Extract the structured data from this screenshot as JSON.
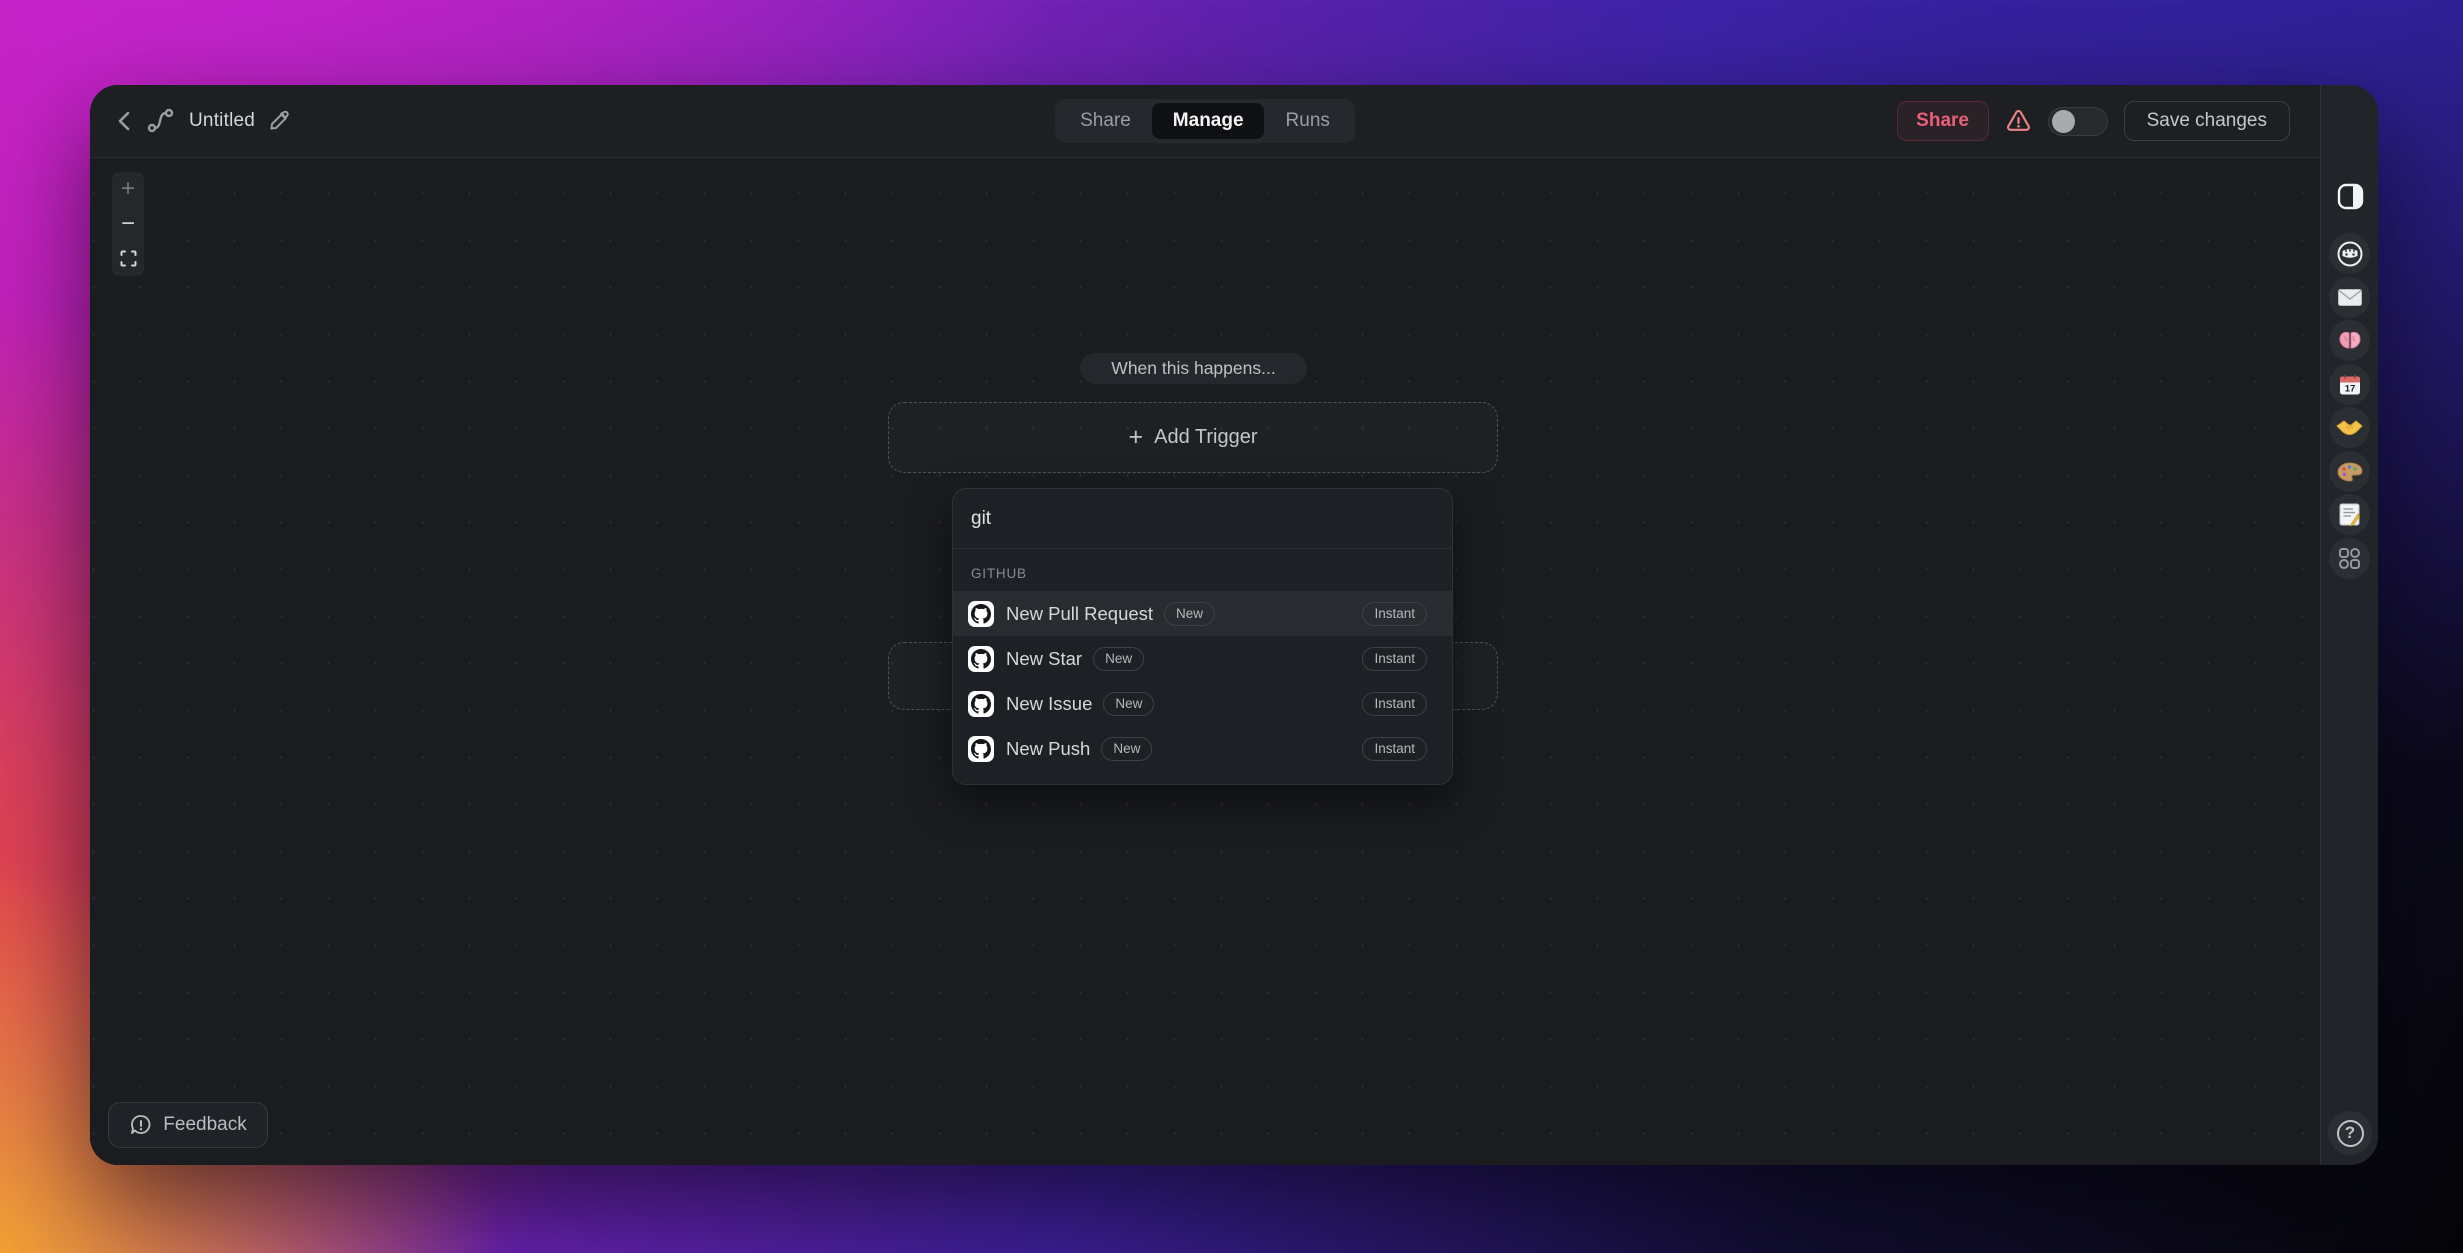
{
  "window": {
    "title": "Untitled"
  },
  "topbar": {
    "tabs": [
      {
        "label": "Share",
        "active": false
      },
      {
        "label": "Manage",
        "active": true
      },
      {
        "label": "Runs",
        "active": false
      }
    ],
    "share_button": "Share",
    "save_button": "Save changes",
    "toggle_state": "off"
  },
  "canvas": {
    "when_label": "When this happens...",
    "add_trigger": {
      "plus": "+",
      "label": "Add Trigger"
    },
    "zoom_controls": {
      "zoom_in": "+",
      "zoom_out": "−",
      "fit": "fit-view"
    }
  },
  "trigger_search": {
    "query": "git",
    "section": "GITHUB",
    "results": [
      {
        "name": "New Pull Request",
        "badge": "New",
        "tag": "Instant",
        "highlighted": true
      },
      {
        "name": "New Star",
        "badge": "New",
        "tag": "Instant",
        "highlighted": false
      },
      {
        "name": "New Issue",
        "badge": "New",
        "tag": "Instant",
        "highlighted": false
      },
      {
        "name": "New Push",
        "badge": "New",
        "tag": "Instant",
        "highlighted": false
      }
    ]
  },
  "feedback": {
    "label": "Feedback"
  },
  "rail": {
    "icons": [
      "panel-toggle",
      "robot",
      "envelope",
      "brain",
      "calendar-17",
      "handshake",
      "palette",
      "memo",
      "apps-grid",
      "help"
    ]
  },
  "colors": {
    "accent_red": "#e95f78",
    "warning": "#ee8585",
    "canvas_bg": "#1a1c1f",
    "panel_bg": "#1d2024",
    "highlight_row": "#282b30"
  }
}
